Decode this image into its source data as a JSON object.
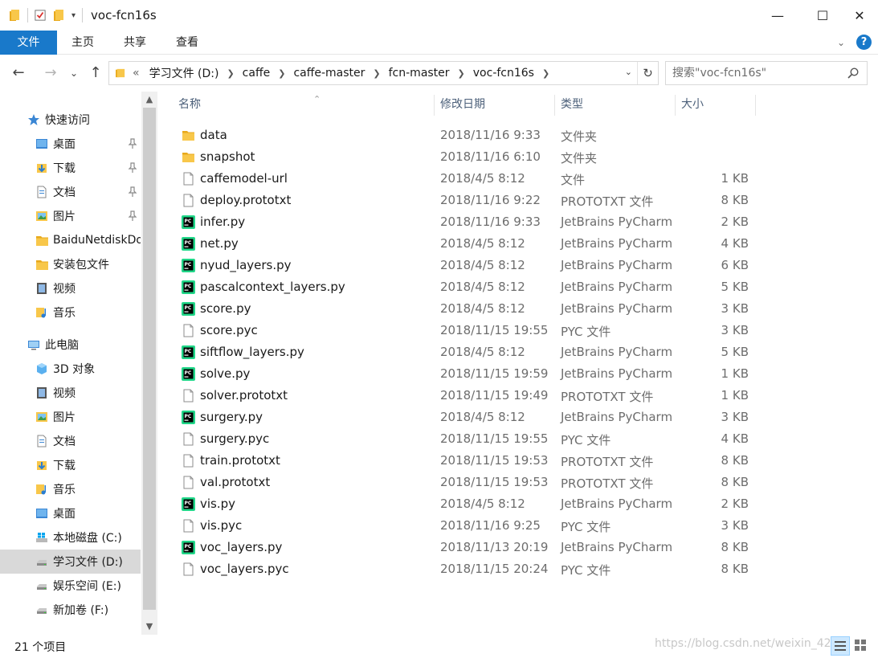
{
  "window": {
    "title": "voc-fcn16s",
    "minimize": "—",
    "maximize": "☐",
    "close": "✕"
  },
  "ribbon": {
    "tabs": [
      "文件",
      "主页",
      "共享",
      "查看"
    ]
  },
  "address": {
    "prefix": "«",
    "crumbs": [
      "学习文件 (D:)",
      "caffe",
      "caffe-master",
      "fcn-master",
      "voc-fcn16s"
    ],
    "search_placeholder": "搜索\"voc-fcn16s\""
  },
  "nav": {
    "quick_access": "快速访问",
    "quick_items": [
      "桌面",
      "下载",
      "文档",
      "图片",
      "BaiduNetdiskDownload",
      "安装包文件",
      "视频",
      "音乐"
    ],
    "this_pc": "此电脑",
    "pc_items": [
      "3D 对象",
      "视频",
      "图片",
      "文档",
      "下载",
      "音乐",
      "桌面",
      "本地磁盘 (C:)",
      "学习文件 (D:)",
      "娱乐空间 (E:)",
      "新加卷 (F:)"
    ]
  },
  "columns": {
    "name": "名称",
    "date": "修改日期",
    "type": "类型",
    "size": "大小"
  },
  "files": [
    {
      "name": "data",
      "date": "2018/11/16 9:33",
      "type": "文件夹",
      "size": "",
      "icon": "folder"
    },
    {
      "name": "snapshot",
      "date": "2018/11/16 6:10",
      "type": "文件夹",
      "size": "",
      "icon": "folder"
    },
    {
      "name": "caffemodel-url",
      "date": "2018/4/5 8:12",
      "type": "文件",
      "size": "1 KB",
      "icon": "file"
    },
    {
      "name": "deploy.prototxt",
      "date": "2018/11/16 9:22",
      "type": "PROTOTXT 文件",
      "size": "8 KB",
      "icon": "file"
    },
    {
      "name": "infer.py",
      "date": "2018/11/16 9:33",
      "type": "JetBrains PyCharm",
      "size": "2 KB",
      "icon": "pycharm"
    },
    {
      "name": "net.py",
      "date": "2018/4/5 8:12",
      "type": "JetBrains PyCharm",
      "size": "4 KB",
      "icon": "pycharm"
    },
    {
      "name": "nyud_layers.py",
      "date": "2018/4/5 8:12",
      "type": "JetBrains PyCharm",
      "size": "6 KB",
      "icon": "pycharm"
    },
    {
      "name": "pascalcontext_layers.py",
      "date": "2018/4/5 8:12",
      "type": "JetBrains PyCharm",
      "size": "5 KB",
      "icon": "pycharm"
    },
    {
      "name": "score.py",
      "date": "2018/4/5 8:12",
      "type": "JetBrains PyCharm",
      "size": "3 KB",
      "icon": "pycharm"
    },
    {
      "name": "score.pyc",
      "date": "2018/11/15 19:55",
      "type": "PYC 文件",
      "size": "3 KB",
      "icon": "file"
    },
    {
      "name": "siftflow_layers.py",
      "date": "2018/4/5 8:12",
      "type": "JetBrains PyCharm",
      "size": "5 KB",
      "icon": "pycharm"
    },
    {
      "name": "solve.py",
      "date": "2018/11/15 19:59",
      "type": "JetBrains PyCharm",
      "size": "1 KB",
      "icon": "pycharm"
    },
    {
      "name": "solver.prototxt",
      "date": "2018/11/15 19:49",
      "type": "PROTOTXT 文件",
      "size": "1 KB",
      "icon": "file"
    },
    {
      "name": "surgery.py",
      "date": "2018/4/5 8:12",
      "type": "JetBrains PyCharm",
      "size": "3 KB",
      "icon": "pycharm"
    },
    {
      "name": "surgery.pyc",
      "date": "2018/11/15 19:55",
      "type": "PYC 文件",
      "size": "4 KB",
      "icon": "file"
    },
    {
      "name": "train.prototxt",
      "date": "2018/11/15 19:53",
      "type": "PROTOTXT 文件",
      "size": "8 KB",
      "icon": "file"
    },
    {
      "name": "val.prototxt",
      "date": "2018/11/15 19:53",
      "type": "PROTOTXT 文件",
      "size": "8 KB",
      "icon": "file"
    },
    {
      "name": "vis.py",
      "date": "2018/4/5 8:12",
      "type": "JetBrains PyCharm",
      "size": "2 KB",
      "icon": "pycharm"
    },
    {
      "name": "vis.pyc",
      "date": "2018/11/16 9:25",
      "type": "PYC 文件",
      "size": "3 KB",
      "icon": "file"
    },
    {
      "name": "voc_layers.py",
      "date": "2018/11/13 20:19",
      "type": "JetBrains PyCharm",
      "size": "8 KB",
      "icon": "pycharm"
    },
    {
      "name": "voc_layers.pyc",
      "date": "2018/11/15 20:24",
      "type": "PYC 文件",
      "size": "8 KB",
      "icon": "file"
    }
  ],
  "status": {
    "count": "21 个项目",
    "watermark": "https://blog.csdn.net/weixin_42"
  },
  "colors": {
    "accent": "#1979ca",
    "folder": "#f8c74a",
    "selected_nav": "#d9d9d9"
  }
}
